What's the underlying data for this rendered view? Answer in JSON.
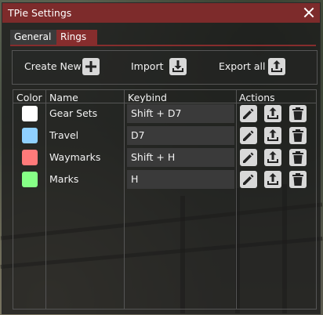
{
  "window": {
    "title": "TPie Settings"
  },
  "tabs": [
    {
      "label": "General"
    },
    {
      "label": "Rings",
      "active": true
    }
  ],
  "toolbar": {
    "create_new_label": "Create New",
    "import_label": "Import",
    "export_all_label": "Export all"
  },
  "table": {
    "headers": {
      "color": "Color",
      "name": "Name",
      "keybind": "Keybind",
      "actions": "Actions"
    },
    "rows": [
      {
        "color": "#ffffff",
        "name": "Gear Sets",
        "keybind": "Shift + D7"
      },
      {
        "color": "#8fd0ff",
        "name": "Travel",
        "keybind": "D7"
      },
      {
        "color": "#ff7a7a",
        "name": "Waymarks",
        "keybind": "Shift + H"
      },
      {
        "color": "#86ff86",
        "name": "Marks",
        "keybind": "H"
      }
    ]
  },
  "icons": {
    "close": "close-icon",
    "add": "plus-icon",
    "import": "import-icon",
    "export": "export-icon",
    "edit": "pencil-icon",
    "delete": "trash-icon"
  },
  "colors": {
    "titlebar": "#7d2b2b",
    "accent": "#862d2d",
    "button": "#d8d8d8"
  }
}
